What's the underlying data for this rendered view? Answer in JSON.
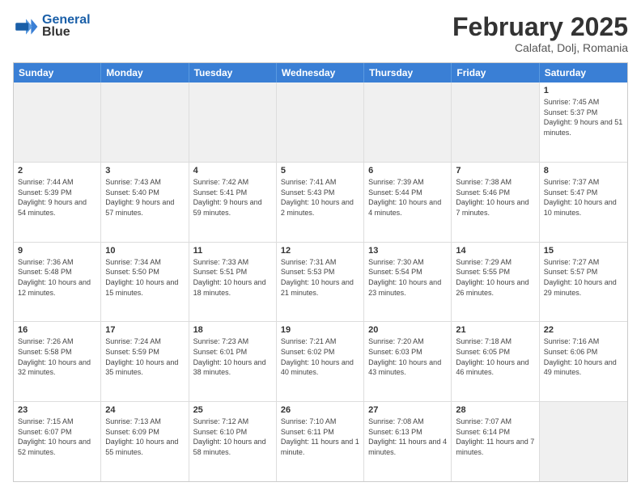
{
  "header": {
    "logo_line1": "General",
    "logo_line2": "Blue",
    "month": "February 2025",
    "location": "Calafat, Dolj, Romania"
  },
  "weekdays": [
    "Sunday",
    "Monday",
    "Tuesday",
    "Wednesday",
    "Thursday",
    "Friday",
    "Saturday"
  ],
  "rows": [
    [
      {
        "day": "",
        "info": "",
        "shaded": true
      },
      {
        "day": "",
        "info": "",
        "shaded": true
      },
      {
        "day": "",
        "info": "",
        "shaded": true
      },
      {
        "day": "",
        "info": "",
        "shaded": true
      },
      {
        "day": "",
        "info": "",
        "shaded": true
      },
      {
        "day": "",
        "info": "",
        "shaded": true
      },
      {
        "day": "1",
        "info": "Sunrise: 7:45 AM\nSunset: 5:37 PM\nDaylight: 9 hours and 51 minutes.",
        "shaded": false
      }
    ],
    [
      {
        "day": "2",
        "info": "Sunrise: 7:44 AM\nSunset: 5:39 PM\nDaylight: 9 hours and 54 minutes.",
        "shaded": false
      },
      {
        "day": "3",
        "info": "Sunrise: 7:43 AM\nSunset: 5:40 PM\nDaylight: 9 hours and 57 minutes.",
        "shaded": false
      },
      {
        "day": "4",
        "info": "Sunrise: 7:42 AM\nSunset: 5:41 PM\nDaylight: 9 hours and 59 minutes.",
        "shaded": false
      },
      {
        "day": "5",
        "info": "Sunrise: 7:41 AM\nSunset: 5:43 PM\nDaylight: 10 hours and 2 minutes.",
        "shaded": false
      },
      {
        "day": "6",
        "info": "Sunrise: 7:39 AM\nSunset: 5:44 PM\nDaylight: 10 hours and 4 minutes.",
        "shaded": false
      },
      {
        "day": "7",
        "info": "Sunrise: 7:38 AM\nSunset: 5:46 PM\nDaylight: 10 hours and 7 minutes.",
        "shaded": false
      },
      {
        "day": "8",
        "info": "Sunrise: 7:37 AM\nSunset: 5:47 PM\nDaylight: 10 hours and 10 minutes.",
        "shaded": false
      }
    ],
    [
      {
        "day": "9",
        "info": "Sunrise: 7:36 AM\nSunset: 5:48 PM\nDaylight: 10 hours and 12 minutes.",
        "shaded": false
      },
      {
        "day": "10",
        "info": "Sunrise: 7:34 AM\nSunset: 5:50 PM\nDaylight: 10 hours and 15 minutes.",
        "shaded": false
      },
      {
        "day": "11",
        "info": "Sunrise: 7:33 AM\nSunset: 5:51 PM\nDaylight: 10 hours and 18 minutes.",
        "shaded": false
      },
      {
        "day": "12",
        "info": "Sunrise: 7:31 AM\nSunset: 5:53 PM\nDaylight: 10 hours and 21 minutes.",
        "shaded": false
      },
      {
        "day": "13",
        "info": "Sunrise: 7:30 AM\nSunset: 5:54 PM\nDaylight: 10 hours and 23 minutes.",
        "shaded": false
      },
      {
        "day": "14",
        "info": "Sunrise: 7:29 AM\nSunset: 5:55 PM\nDaylight: 10 hours and 26 minutes.",
        "shaded": false
      },
      {
        "day": "15",
        "info": "Sunrise: 7:27 AM\nSunset: 5:57 PM\nDaylight: 10 hours and 29 minutes.",
        "shaded": false
      }
    ],
    [
      {
        "day": "16",
        "info": "Sunrise: 7:26 AM\nSunset: 5:58 PM\nDaylight: 10 hours and 32 minutes.",
        "shaded": false
      },
      {
        "day": "17",
        "info": "Sunrise: 7:24 AM\nSunset: 5:59 PM\nDaylight: 10 hours and 35 minutes.",
        "shaded": false
      },
      {
        "day": "18",
        "info": "Sunrise: 7:23 AM\nSunset: 6:01 PM\nDaylight: 10 hours and 38 minutes.",
        "shaded": false
      },
      {
        "day": "19",
        "info": "Sunrise: 7:21 AM\nSunset: 6:02 PM\nDaylight: 10 hours and 40 minutes.",
        "shaded": false
      },
      {
        "day": "20",
        "info": "Sunrise: 7:20 AM\nSunset: 6:03 PM\nDaylight: 10 hours and 43 minutes.",
        "shaded": false
      },
      {
        "day": "21",
        "info": "Sunrise: 7:18 AM\nSunset: 6:05 PM\nDaylight: 10 hours and 46 minutes.",
        "shaded": false
      },
      {
        "day": "22",
        "info": "Sunrise: 7:16 AM\nSunset: 6:06 PM\nDaylight: 10 hours and 49 minutes.",
        "shaded": false
      }
    ],
    [
      {
        "day": "23",
        "info": "Sunrise: 7:15 AM\nSunset: 6:07 PM\nDaylight: 10 hours and 52 minutes.",
        "shaded": false
      },
      {
        "day": "24",
        "info": "Sunrise: 7:13 AM\nSunset: 6:09 PM\nDaylight: 10 hours and 55 minutes.",
        "shaded": false
      },
      {
        "day": "25",
        "info": "Sunrise: 7:12 AM\nSunset: 6:10 PM\nDaylight: 10 hours and 58 minutes.",
        "shaded": false
      },
      {
        "day": "26",
        "info": "Sunrise: 7:10 AM\nSunset: 6:11 PM\nDaylight: 11 hours and 1 minute.",
        "shaded": false
      },
      {
        "day": "27",
        "info": "Sunrise: 7:08 AM\nSunset: 6:13 PM\nDaylight: 11 hours and 4 minutes.",
        "shaded": false
      },
      {
        "day": "28",
        "info": "Sunrise: 7:07 AM\nSunset: 6:14 PM\nDaylight: 11 hours and 7 minutes.",
        "shaded": false
      },
      {
        "day": "",
        "info": "",
        "shaded": true
      }
    ]
  ]
}
